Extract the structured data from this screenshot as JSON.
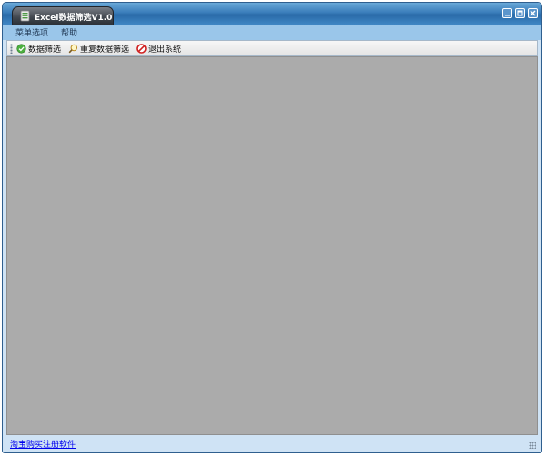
{
  "window": {
    "title": "Excel数据筛选V1.0"
  },
  "menu": {
    "items": [
      {
        "label": "菜单选项"
      },
      {
        "label": "帮助"
      }
    ]
  },
  "toolbar": {
    "buttons": [
      {
        "label": "数据筛选",
        "icon": "check-circle-icon"
      },
      {
        "label": "重复数据筛选",
        "icon": "magnifier-icon"
      },
      {
        "label": "退出系统",
        "icon": "stop-icon"
      }
    ]
  },
  "status": {
    "link_label": "淘宝购买注册软件"
  },
  "colors": {
    "title_bar": "#3a7dba",
    "menu_bar": "#9ac6ea",
    "work_area": "#ababab",
    "link": "#0000ee"
  }
}
